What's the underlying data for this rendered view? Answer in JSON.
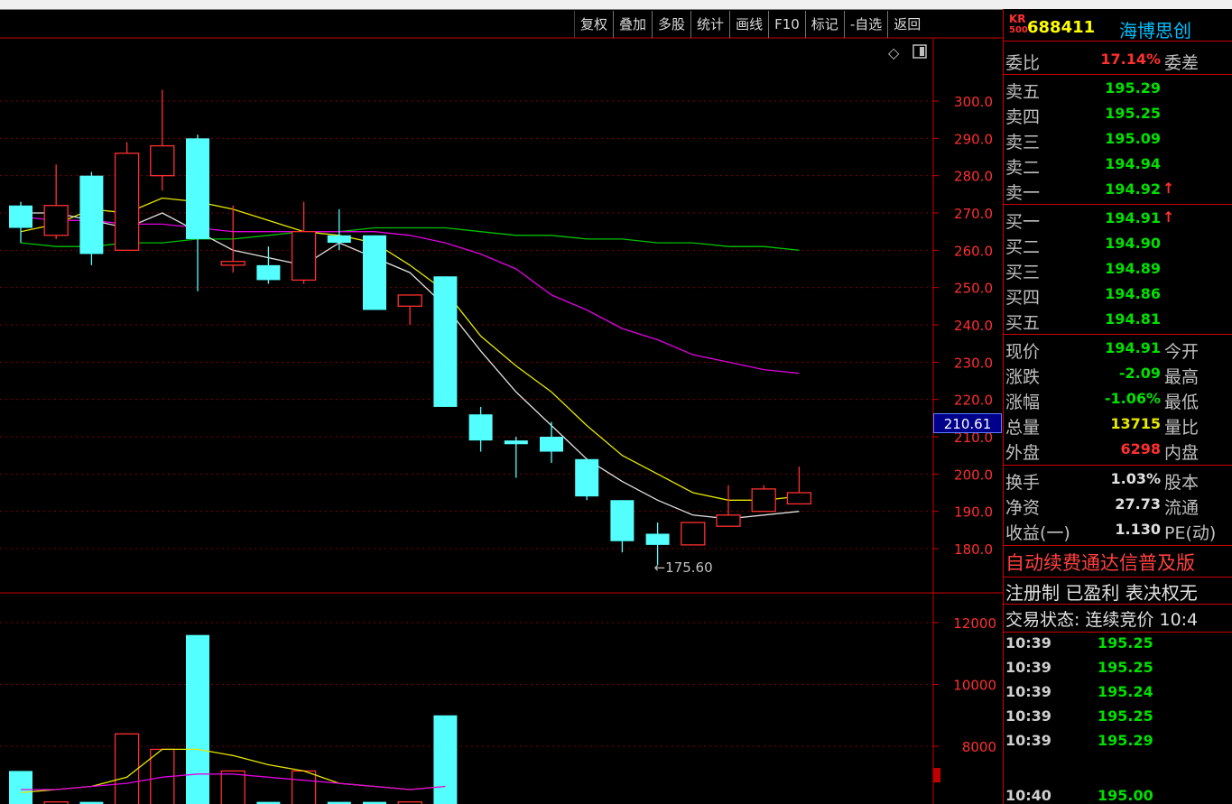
{
  "toolbar": {
    "buttons": [
      "复权",
      "叠加",
      "多股",
      "统计",
      "画线",
      "F10",
      "标记",
      "-自选",
      "返回"
    ]
  },
  "stock": {
    "badge_top": "KR",
    "badge_bottom": "500",
    "code": "688411",
    "name": "海博思创"
  },
  "price_axis": [
    "300.0",
    "290.0",
    "280.0",
    "270.0",
    "260.0",
    "250.0",
    "240.0",
    "230.0",
    "220.0",
    "210.0",
    "200.0",
    "190.0",
    "180.0"
  ],
  "volume_axis": [
    "12000",
    "10000",
    "8000"
  ],
  "current_price_tag": "210.61",
  "low_annotation": "175.60",
  "quote": {
    "weibi": {
      "label": "委比",
      "value": "17.14%",
      "label2": "委差"
    },
    "asks": [
      {
        "label": "卖五",
        "price": "195.29"
      },
      {
        "label": "卖四",
        "price": "195.25"
      },
      {
        "label": "卖三",
        "price": "195.09"
      },
      {
        "label": "卖二",
        "price": "194.94"
      },
      {
        "label": "卖一",
        "price": "194.92"
      }
    ],
    "bids": [
      {
        "label": "买一",
        "price": "194.91"
      },
      {
        "label": "买二",
        "price": "194.90"
      },
      {
        "label": "买三",
        "price": "194.89"
      },
      {
        "label": "买四",
        "price": "194.86"
      },
      {
        "label": "买五",
        "price": "194.81"
      }
    ],
    "stats": [
      {
        "label": "现价",
        "value": "194.91",
        "label2": "今开"
      },
      {
        "label": "涨跌",
        "value": "-2.09",
        "label2": "最高"
      },
      {
        "label": "涨幅",
        "value": "-1.06%",
        "label2": "最低"
      },
      {
        "label": "总量",
        "value": "13715",
        "label2": "量比"
      },
      {
        "label": "外盘",
        "value": "6298",
        "label2": "内盘"
      }
    ],
    "stats2": [
      {
        "label": "换手",
        "value": "1.03%",
        "label2": "股本"
      },
      {
        "label": "净资",
        "value": "27.73",
        "label2": "流通"
      },
      {
        "label": "收益(一)",
        "value": "1.130",
        "label2": "PE(动)"
      }
    ],
    "notice1": "自动续费通达信普及版",
    "notice2": "注册制 已盈利 表决权无",
    "status": "交易状态: 连续竞价 10:4",
    "ticks": [
      {
        "time": "10:39",
        "price": "195.25"
      },
      {
        "time": "10:39",
        "price": "195.25"
      },
      {
        "time": "10:39",
        "price": "195.24"
      },
      {
        "time": "10:39",
        "price": "195.25"
      },
      {
        "time": "10:39",
        "price": "195.29"
      },
      {
        "time": "10:40",
        "price": "195.00"
      }
    ]
  },
  "chart_data": {
    "type": "candlestick",
    "ylim": [
      175,
      305
    ],
    "candles": [
      {
        "o": 272,
        "c": 266,
        "h": 273,
        "l": 262
      },
      {
        "o": 264,
        "c": 272,
        "h": 283,
        "l": 263
      },
      {
        "o": 280,
        "c": 259,
        "h": 281,
        "l": 256
      },
      {
        "o": 260,
        "c": 286,
        "h": 289,
        "l": 260
      },
      {
        "o": 280,
        "c": 288,
        "h": 303,
        "l": 276
      },
      {
        "o": 290,
        "c": 263,
        "h": 291,
        "l": 249
      },
      {
        "o": 256,
        "c": 257,
        "h": 272,
        "l": 254
      },
      {
        "o": 256,
        "c": 252,
        "h": 261,
        "l": 251
      },
      {
        "o": 252,
        "c": 265,
        "h": 273,
        "l": 251
      },
      {
        "o": 264,
        "c": 262,
        "h": 271,
        "l": 260
      },
      {
        "o": 264,
        "c": 244,
        "h": 264,
        "l": 244
      },
      {
        "o": 245,
        "c": 248,
        "h": 248,
        "l": 240
      },
      {
        "o": 253,
        "c": 218,
        "h": 253,
        "l": 218
      },
      {
        "o": 216,
        "c": 209,
        "h": 218,
        "l": 206
      },
      {
        "o": 209,
        "c": 208,
        "h": 210,
        "l": 199
      },
      {
        "o": 210,
        "c": 206,
        "h": 214,
        "l": 203
      },
      {
        "o": 204,
        "c": 194,
        "h": 204,
        "l": 193
      },
      {
        "o": 193,
        "c": 182,
        "h": 193,
        "l": 179
      },
      {
        "o": 184,
        "c": 181,
        "h": 187,
        "l": 175.6
      },
      {
        "o": 181,
        "c": 187,
        "h": 187,
        "l": 181
      },
      {
        "o": 186,
        "c": 189,
        "h": 197,
        "l": 186
      },
      {
        "o": 190,
        "c": 196,
        "h": 197,
        "l": 190
      },
      {
        "o": 192,
        "c": 195,
        "h": 202,
        "l": 192
      }
    ],
    "ma_white": [
      270,
      270,
      268,
      266,
      270,
      265,
      260,
      258,
      256,
      262,
      258,
      254,
      245,
      233,
      222,
      213,
      204,
      198,
      193,
      189,
      188,
      189,
      190
    ],
    "ma_yellow": [
      265,
      267,
      271,
      270,
      274,
      273,
      271,
      268,
      265,
      264,
      262,
      256,
      249,
      237,
      229,
      222,
      213,
      205,
      200,
      195,
      193,
      193,
      194
    ],
    "ma_magenta": [
      269,
      268,
      268,
      267,
      267,
      266,
      265,
      265,
      265,
      265,
      265,
      264,
      262,
      259,
      255,
      248,
      244,
      239,
      236,
      232,
      230,
      228,
      227
    ],
    "ma_green": [
      262,
      261,
      261,
      262,
      262,
      263,
      263,
      264,
      265,
      265,
      266,
      266,
      266,
      265,
      264,
      264,
      263,
      263,
      262,
      262,
      261,
      261,
      260
    ],
    "volume": {
      "ylim": [
        6500,
        12500
      ],
      "bars": [
        7200,
        6200,
        6200,
        8400,
        7900,
        11600,
        7200,
        6200,
        7200,
        6200,
        6200,
        6200,
        9000
      ],
      "ma_yellow": [
        6500,
        6600,
        6700,
        7000,
        7900,
        7900,
        7700,
        7400,
        7200,
        6800,
        6700,
        6600,
        6700
      ],
      "ma_magenta": [
        6600,
        6600,
        6700,
        6800,
        7000,
        7100,
        7100,
        7000,
        6900,
        6800,
        6700,
        6600,
        6700
      ]
    }
  }
}
